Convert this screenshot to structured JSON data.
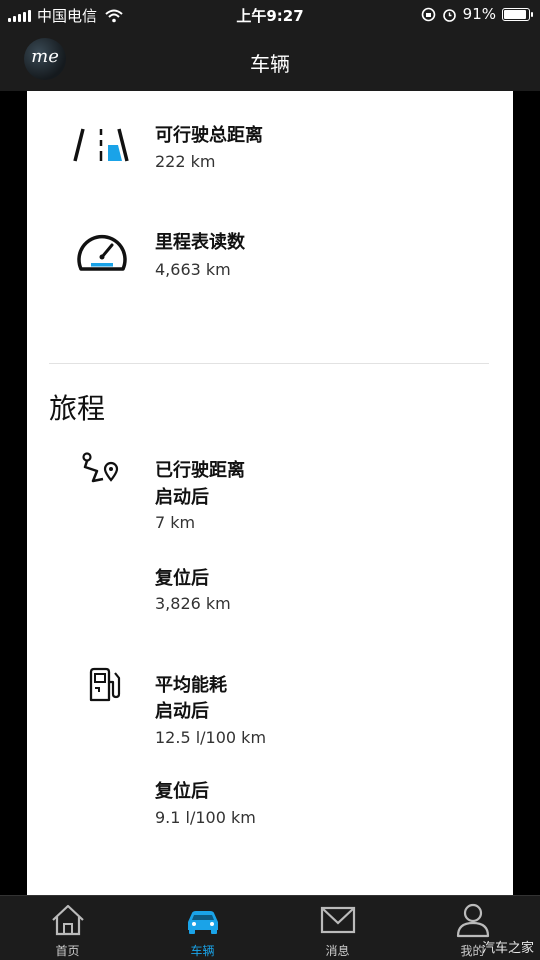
{
  "status_bar": {
    "carrier": "中国电信",
    "time": "上午9:27",
    "battery": "91%",
    "battery_level": 0.91
  },
  "nav": {
    "logo_text": "me",
    "title": "车辆"
  },
  "vehicle": {
    "range": {
      "label": "可行驶总距离",
      "value": "222 km",
      "icon": "road-range-icon"
    },
    "odometer": {
      "label": "里程表读数",
      "value": "4,663 km",
      "icon": "speedometer-icon"
    }
  },
  "trip": {
    "title": "旅程",
    "distance": {
      "label": "已行驶距离",
      "since_start_label": "启动后",
      "since_start_value": "7 km",
      "since_reset_label": "复位后",
      "since_reset_value": "3,826 km",
      "icon": "route-icon"
    },
    "consumption": {
      "label": "平均能耗",
      "since_start_label": "启动后",
      "since_start_value": "12.5 l/100 km",
      "since_reset_label": "复位后",
      "since_reset_value": "9.1 l/100 km",
      "icon": "fuel-pump-icon"
    }
  },
  "tabs": [
    {
      "label": "首页",
      "icon": "home-icon",
      "active": false
    },
    {
      "label": "车辆",
      "icon": "car-icon",
      "active": true
    },
    {
      "label": "消息",
      "icon": "envelope-icon",
      "active": false
    },
    {
      "label": "我的",
      "icon": "user-icon",
      "active": false
    }
  ],
  "watermark": "汽车之家",
  "colors": {
    "accent": "#1aa3e8",
    "bar": "#1c1c1c"
  }
}
